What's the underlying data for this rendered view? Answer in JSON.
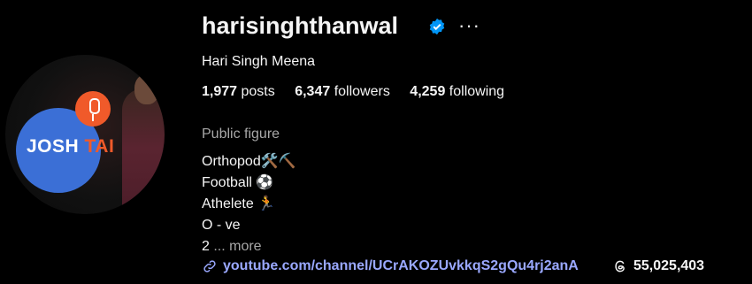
{
  "profile": {
    "username": "harisinghthanwal",
    "full_name": "Hari Singh Meena",
    "avatar_text": "JOSH",
    "avatar_text_tail": "TAI",
    "verified_icon": "verified-badge-icon",
    "more_glyph": "···"
  },
  "stats": {
    "posts_count": "1,977",
    "posts_label": "posts",
    "followers_count": "6,347",
    "followers_label": "followers",
    "following_count": "4,259",
    "following_label": "following"
  },
  "bio": {
    "category": "Public figure",
    "line1": "Orthopod🛠️⛏️",
    "line2": "Football ⚽",
    "line3": "Athelete 🏃",
    "line4": "O - ve",
    "line5_start": "2 ",
    "more": "... more"
  },
  "links": {
    "url": "youtube.com/channel/UCrAKOZUvkkqS2gQu4rj2anA",
    "threads_count": "55,025,403"
  },
  "colors": {
    "background": "#000000",
    "link": "#9aa8ff",
    "verified": "#0095f6"
  }
}
